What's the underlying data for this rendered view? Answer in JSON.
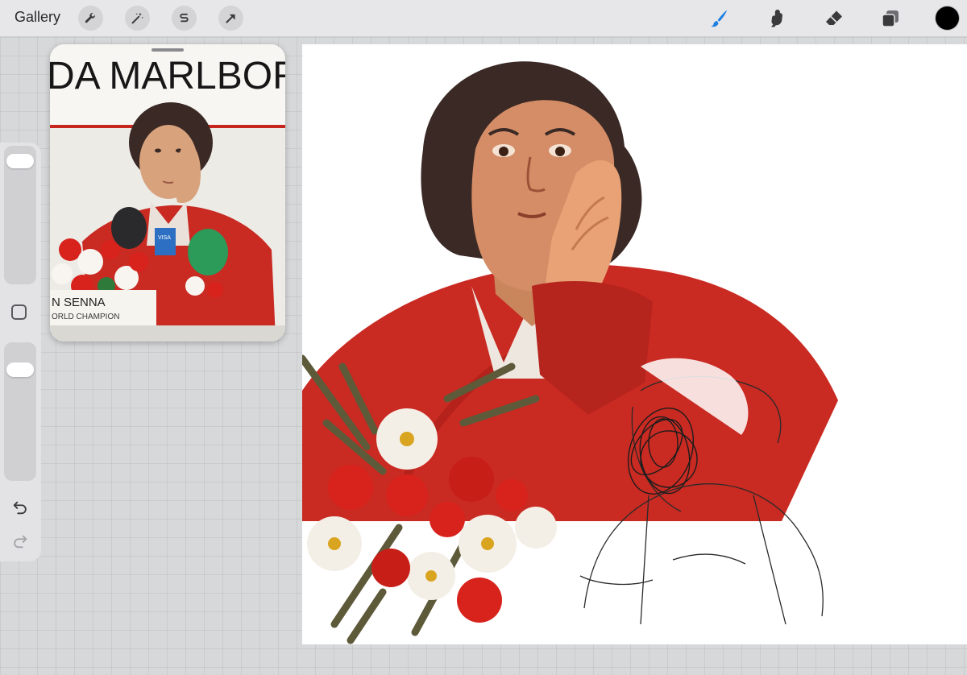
{
  "toolbar": {
    "gallery_label": "Gallery",
    "left_tools": [
      "wrench-icon",
      "magic-wand-icon",
      "selection-icon",
      "transform-arrow-icon"
    ],
    "right_tools": [
      "brush-icon",
      "smudge-icon",
      "eraser-icon",
      "layers-icon"
    ],
    "active_tool": "brush-icon",
    "active_color": "#000000",
    "accent_color": "#1f7fe0"
  },
  "sidebar": {
    "brush_size_level": 0.95,
    "opacity_level": 0.85,
    "buttons": [
      "modify-square-icon",
      "undo-icon",
      "redo-icon"
    ]
  },
  "reference": {
    "sign_text": "DA MARLBOR",
    "nameplate_line1": "N SENNA",
    "nameplate_line2": "ORLD CHAMPION",
    "mic_label": "VISA"
  },
  "colors": {
    "jacket_red": "#c92a22",
    "skin": "#d48d66",
    "hair": "#3a2925",
    "daisy": "#f4efe6",
    "stem": "#5d5a3a"
  }
}
